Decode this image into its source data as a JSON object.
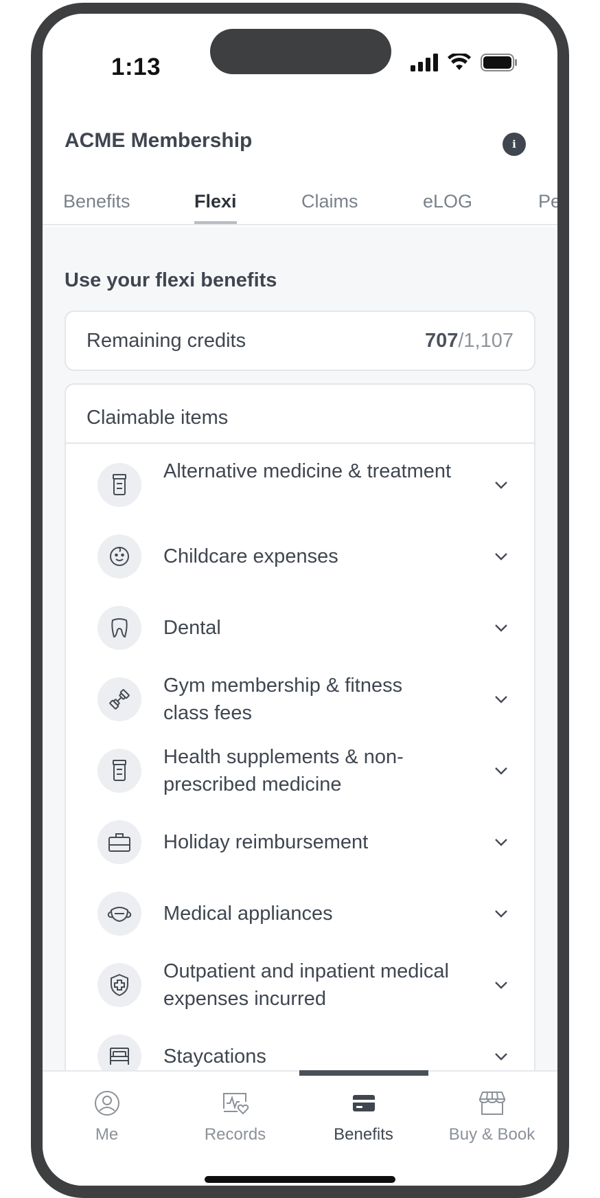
{
  "status_bar": {
    "time": "1:13"
  },
  "header": {
    "title": "ACME Membership",
    "info_icon": "info-icon"
  },
  "tabs": [
    {
      "label": "Benefits",
      "active": false
    },
    {
      "label": "Flexi",
      "active": true
    },
    {
      "label": "Claims",
      "active": false
    },
    {
      "label": "eLOG",
      "active": false
    },
    {
      "label": "Pe",
      "active": false
    }
  ],
  "main": {
    "section_title": "Use your flexi benefits",
    "credits": {
      "label": "Remaining credits",
      "remaining": "707",
      "total": "/1,107"
    },
    "claimable": {
      "title": "Claimable items",
      "items": [
        {
          "label": "Alternative medicine & treatment",
          "icon": "pill-bottle-icon"
        },
        {
          "label": "Childcare expenses",
          "icon": "baby-face-icon"
        },
        {
          "label": "Dental",
          "icon": "tooth-icon"
        },
        {
          "label": "Gym membership & fitness class fees",
          "icon": "dumbbell-icon"
        },
        {
          "label": "Health supplements & non-prescribed medicine",
          "icon": "pill-bottle-icon"
        },
        {
          "label": "Holiday reimbursement",
          "icon": "suitcase-icon"
        },
        {
          "label": "Medical appliances",
          "icon": "face-mask-icon"
        },
        {
          "label": "Outpatient and inpatient medical expenses incurred",
          "icon": "shield-cross-icon"
        },
        {
          "label": "Staycations",
          "icon": "bed-icon"
        }
      ]
    }
  },
  "bottom_nav": [
    {
      "label": "Me",
      "icon": "user-circle-icon",
      "active": false
    },
    {
      "label": "Records",
      "icon": "health-records-icon",
      "active": false
    },
    {
      "label": "Benefits",
      "icon": "card-icon",
      "active": true
    },
    {
      "label": "Buy & Book",
      "icon": "store-icon",
      "active": false
    }
  ]
}
